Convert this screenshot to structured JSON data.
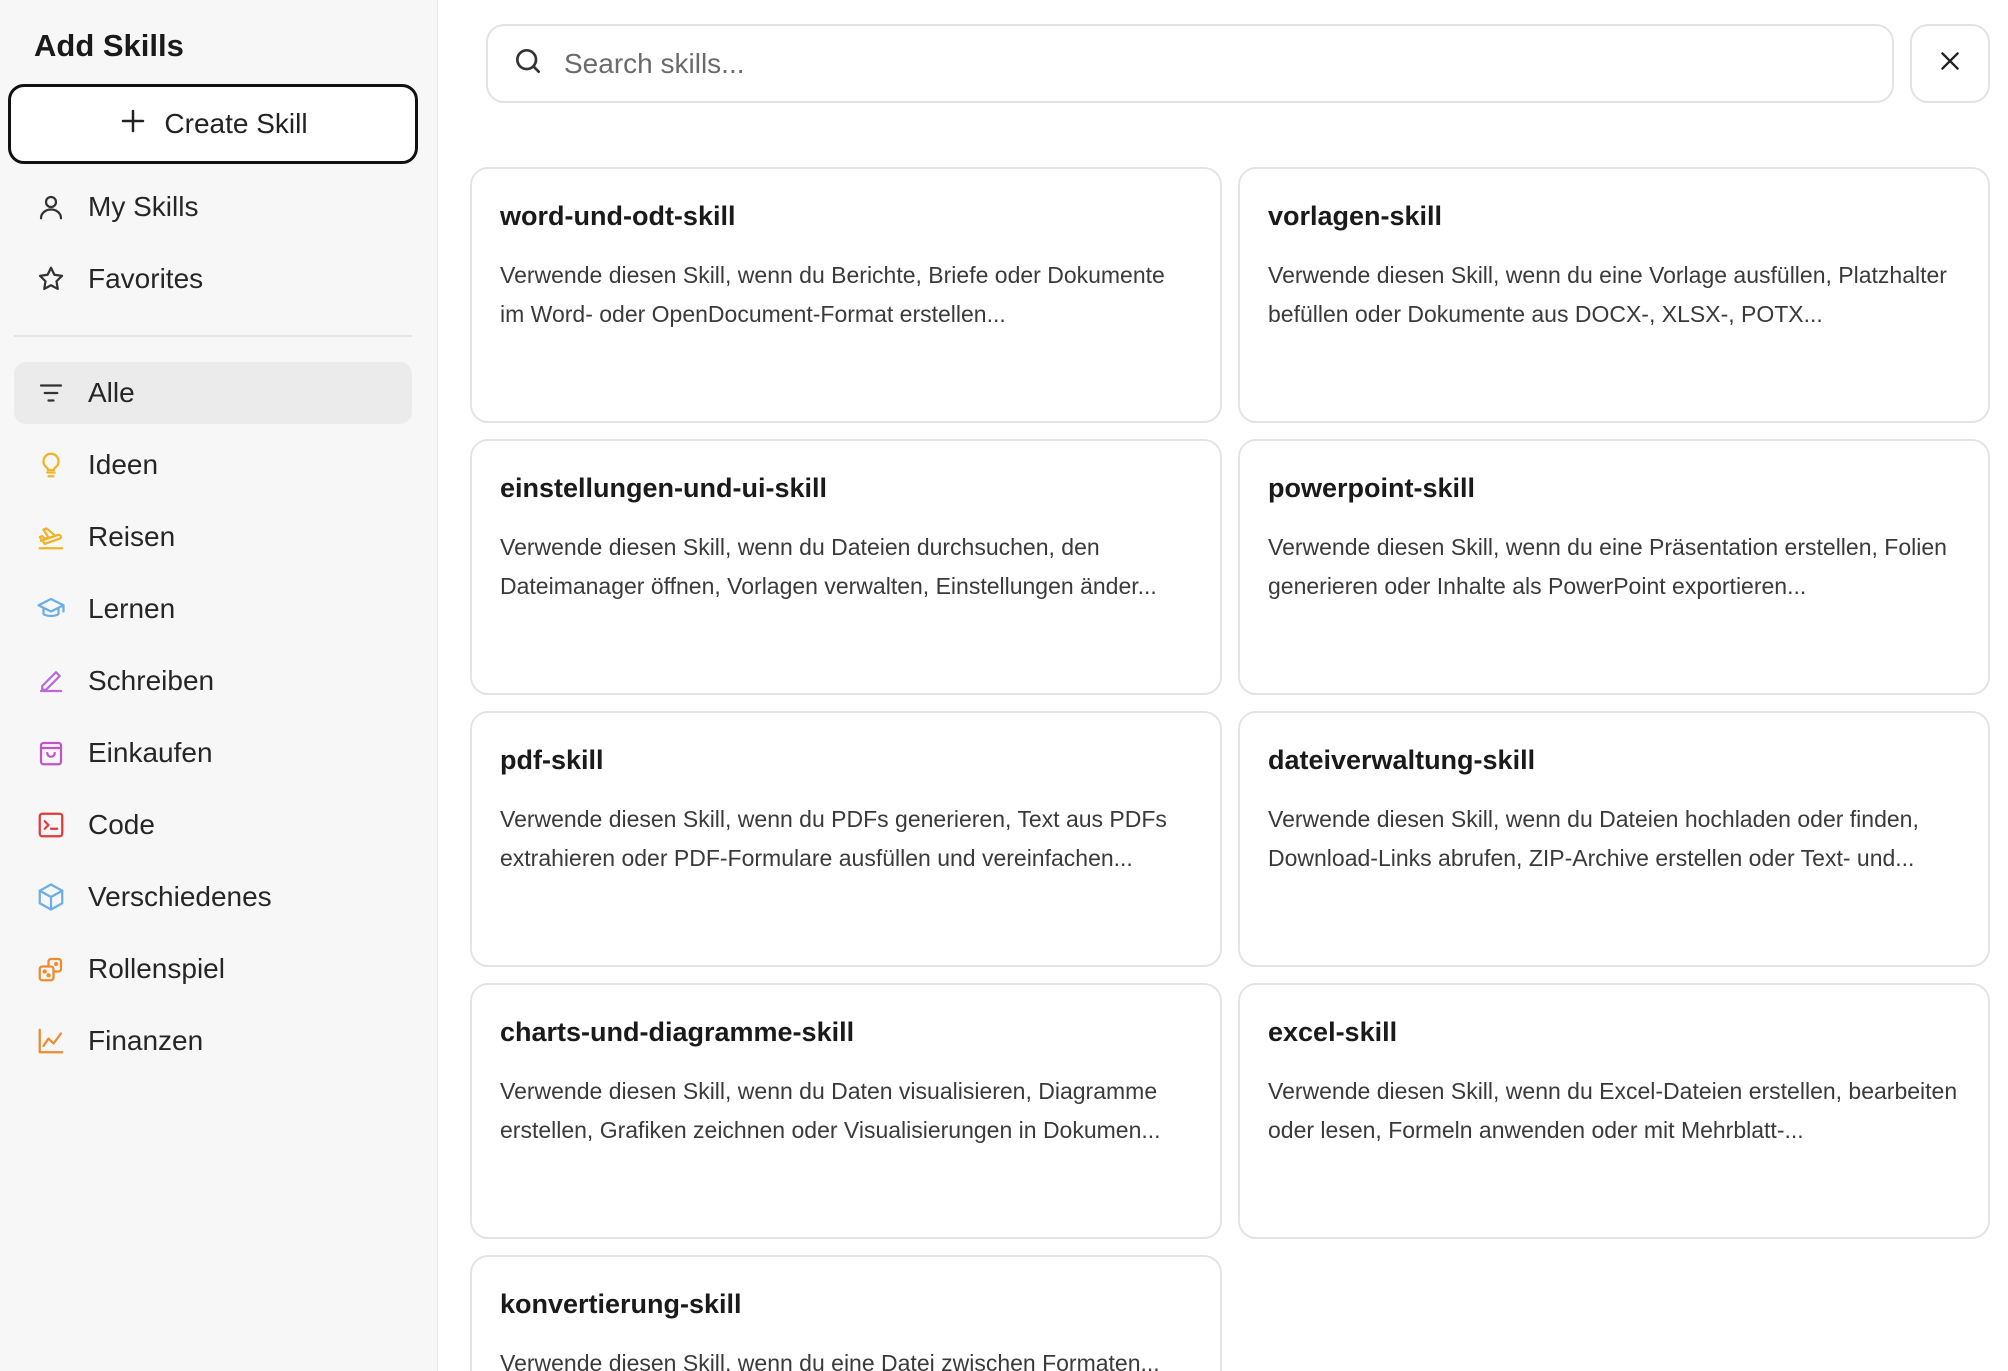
{
  "sidebar": {
    "title": "Add Skills",
    "create_label": "Create Skill",
    "top_items": [
      {
        "label": "My Skills",
        "icon": "user-icon"
      },
      {
        "label": "Favorites",
        "icon": "star-icon"
      }
    ],
    "categories": [
      {
        "label": "Alle",
        "icon": "filter-icon",
        "color": "#333333",
        "active": true
      },
      {
        "label": "Ideen",
        "icon": "lightbulb-icon",
        "color": "#f0b429"
      },
      {
        "label": "Reisen",
        "icon": "plane-icon",
        "color": "#f0b429"
      },
      {
        "label": "Lernen",
        "icon": "graduation-cap-icon",
        "color": "#6aaee8"
      },
      {
        "label": "Schreiben",
        "icon": "pen-icon",
        "color": "#b86ad8"
      },
      {
        "label": "Einkaufen",
        "icon": "shopping-bag-icon",
        "color": "#c255c6"
      },
      {
        "label": "Code",
        "icon": "code-icon",
        "color": "#e03b3b"
      },
      {
        "label": "Verschiedenes",
        "icon": "box-icon",
        "color": "#6aaee8"
      },
      {
        "label": "Rollenspiel",
        "icon": "dice-icon",
        "color": "#f08a2c"
      },
      {
        "label": "Finanzen",
        "icon": "chart-line-icon",
        "color": "#f08a2c"
      }
    ]
  },
  "search": {
    "placeholder": "Search skills..."
  },
  "skills": [
    {
      "title": "word-und-odt-skill",
      "description": "Verwende diesen Skill, wenn du Berichte, Briefe oder Dokumente im Word- oder OpenDocument-Format erstellen..."
    },
    {
      "title": "vorlagen-skill",
      "description": "Verwende diesen Skill, wenn du eine Vorlage ausfüllen, Platzhalter befüllen oder Dokumente aus DOCX-, XLSX-, POTX..."
    },
    {
      "title": "einstellungen-und-ui-skill",
      "description": "Verwende diesen Skill, wenn du Dateien durchsuchen, den Dateimanager öffnen, Vorlagen verwalten, Einstellungen änder..."
    },
    {
      "title": "powerpoint-skill",
      "description": "Verwende diesen Skill, wenn du eine Präsentation erstellen, Folien generieren oder Inhalte als PowerPoint exportieren..."
    },
    {
      "title": "pdf-skill",
      "description": "Verwende diesen Skill, wenn du PDFs generieren, Text aus PDFs extrahieren oder PDF-Formulare ausfüllen und vereinfachen..."
    },
    {
      "title": "dateiverwaltung-skill",
      "description": "Verwende diesen Skill, wenn du Dateien hochladen oder finden, Download-Links abrufen, ZIP-Archive erstellen oder Text- und..."
    },
    {
      "title": "charts-und-diagramme-skill",
      "description": "Verwende diesen Skill, wenn du Daten visualisieren, Diagramme erstellen, Grafiken zeichnen oder Visualisierungen in Dokumen..."
    },
    {
      "title": "excel-skill",
      "description": "Verwende diesen Skill, wenn du Excel-Dateien erstellen, bearbeiten oder lesen, Formeln anwenden oder mit Mehrblatt-..."
    },
    {
      "title": "konvertierung-skill",
      "description": "Verwende diesen Skill, wenn du eine Datei zwischen Formaten..."
    }
  ]
}
